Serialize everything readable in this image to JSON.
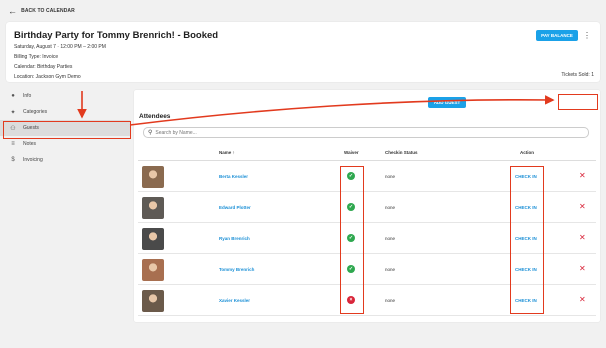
{
  "topbar": {
    "back_label": "BACK TO CALENDAR"
  },
  "header": {
    "title": "Birthday Party for Tommy Brenrich! - Booked",
    "date_line": "Saturday, August 7  ·  12:00 PM – 2:00 PM",
    "billing": "Billing Type: Invoice",
    "calendar": "Calendar: Birthday Parties",
    "location": "Location: Jackson Gym Demo",
    "tickets": "Tickets Sold: 1",
    "pay_label": "PAY BALANCE"
  },
  "sidebar": {
    "items": [
      {
        "label": "Info",
        "icon": "info-icon"
      },
      {
        "label": "Categories",
        "icon": "person-icon"
      },
      {
        "label": "Guests",
        "icon": "group-icon"
      },
      {
        "label": "Notes",
        "icon": "notes-icon"
      },
      {
        "label": "Invoicing",
        "icon": "dollar-icon"
      }
    ],
    "active": "Guests"
  },
  "attendees": {
    "title": "Attendees",
    "add_label": "ADD GUEST",
    "search_placeholder": "Search by Name...",
    "columns": {
      "name": "Name",
      "waiver": "Waiver",
      "status": "Checkin Status",
      "action": "Action"
    },
    "rows": [
      {
        "name": "Berta Kessler",
        "waiver": true,
        "status": "none",
        "action": "CHECK IN",
        "avatar_color": "#8a6a4f"
      },
      {
        "name": "Edward Plotter",
        "waiver": true,
        "status": "none",
        "action": "CHECK IN",
        "avatar_color": "#5e5a55"
      },
      {
        "name": "Ryan Brenrich",
        "waiver": true,
        "status": "none",
        "action": "CHECK IN",
        "avatar_color": "#4a4a4a"
      },
      {
        "name": "Tommy Brenrich",
        "waiver": true,
        "status": "none",
        "action": "CHECK IN",
        "avatar_color": "#a86f50"
      },
      {
        "name": "Xavier Kessler",
        "waiver": false,
        "status": "none",
        "action": "CHECK IN",
        "avatar_color": "#6b5a4a"
      }
    ]
  },
  "colors": {
    "accent": "#1aa1e8",
    "annotation": "#e23a1e",
    "ok": "#2fa84f",
    "error": "#d9263a"
  }
}
